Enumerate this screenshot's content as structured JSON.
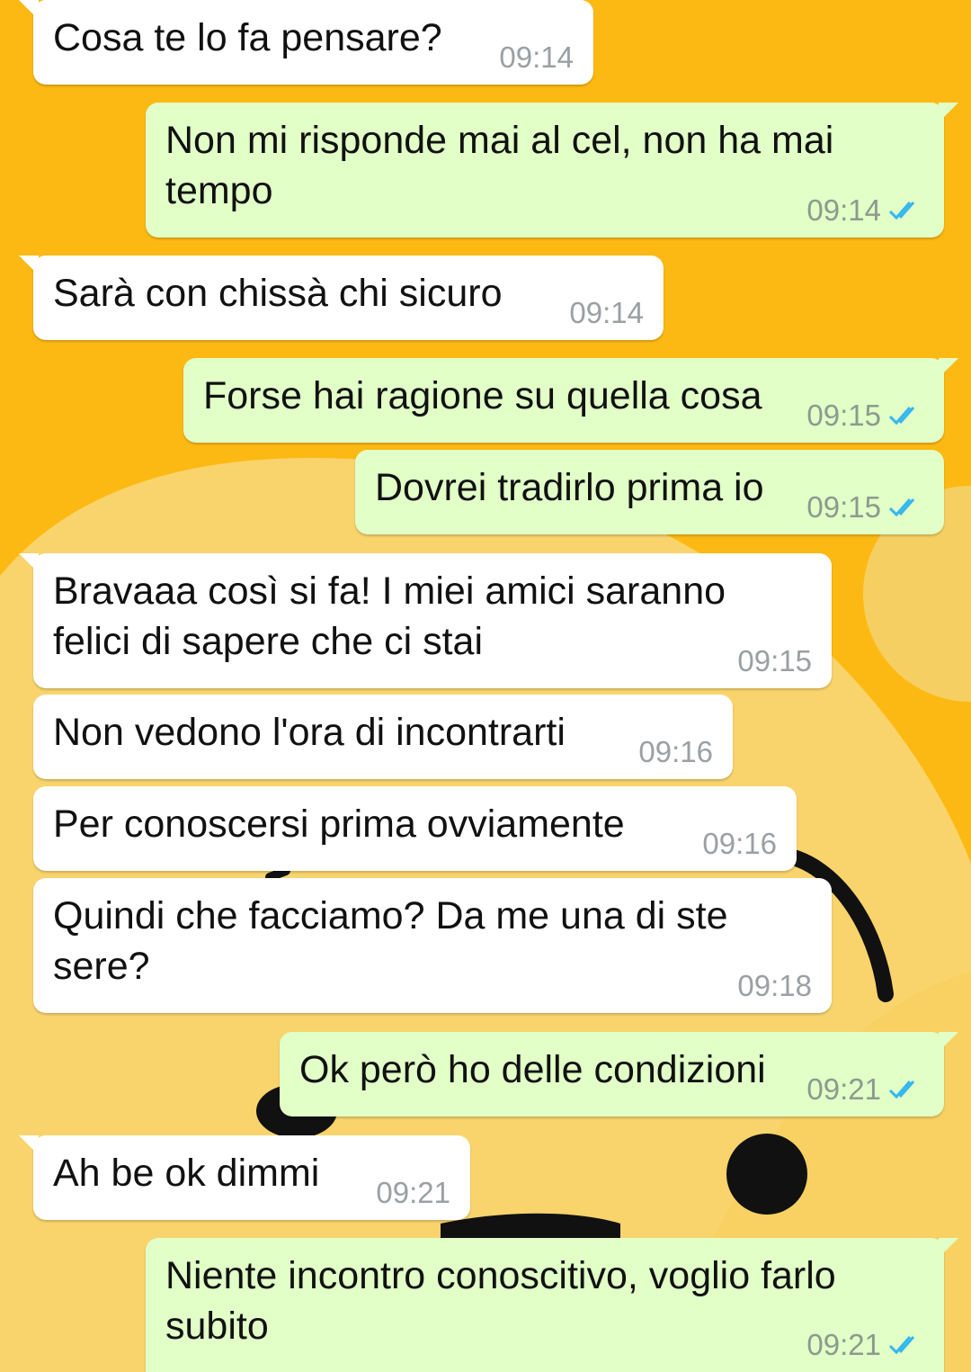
{
  "theme": {
    "wallpaper": "#FDB913",
    "incoming": "#FFFFFF",
    "outgoing": "#E1FFC7",
    "tick": "#34B7F1"
  },
  "messages": [
    {
      "dir": "in",
      "text": "Cosa te lo fa pensare?",
      "time": "09:14"
    },
    {
      "dir": "out",
      "text": "Non mi risponde mai al cel, non ha mai tempo",
      "time": "09:14",
      "status": "read"
    },
    {
      "dir": "in",
      "text": "Sarà con chissà chi sicuro",
      "time": "09:14"
    },
    {
      "dir": "out",
      "text": "Forse hai ragione su quella cosa",
      "time": "09:15",
      "status": "read"
    },
    {
      "dir": "out",
      "text": "Dovrei tradirlo prima io",
      "time": "09:15",
      "status": "read"
    },
    {
      "dir": "in",
      "text": "Bravaaa così si fa! I miei amici saranno felici di sapere che ci stai",
      "time": "09:15"
    },
    {
      "dir": "in",
      "text": "Non vedono l'ora di incontrarti",
      "time": "09:16"
    },
    {
      "dir": "in",
      "text": "Per conoscersi prima ovviamente",
      "time": "09:16"
    },
    {
      "dir": "in",
      "text": "Quindi che facciamo? Da me una di ste sere?",
      "time": "09:18"
    },
    {
      "dir": "out",
      "text": "Ok però ho delle condizioni",
      "time": "09:21",
      "status": "read"
    },
    {
      "dir": "in",
      "text": "Ah be ok dimmi",
      "time": "09:21"
    },
    {
      "dir": "out",
      "text": "Niente incontro conoscitivo, voglio farlo subito",
      "time": "09:21",
      "status": "read"
    }
  ]
}
